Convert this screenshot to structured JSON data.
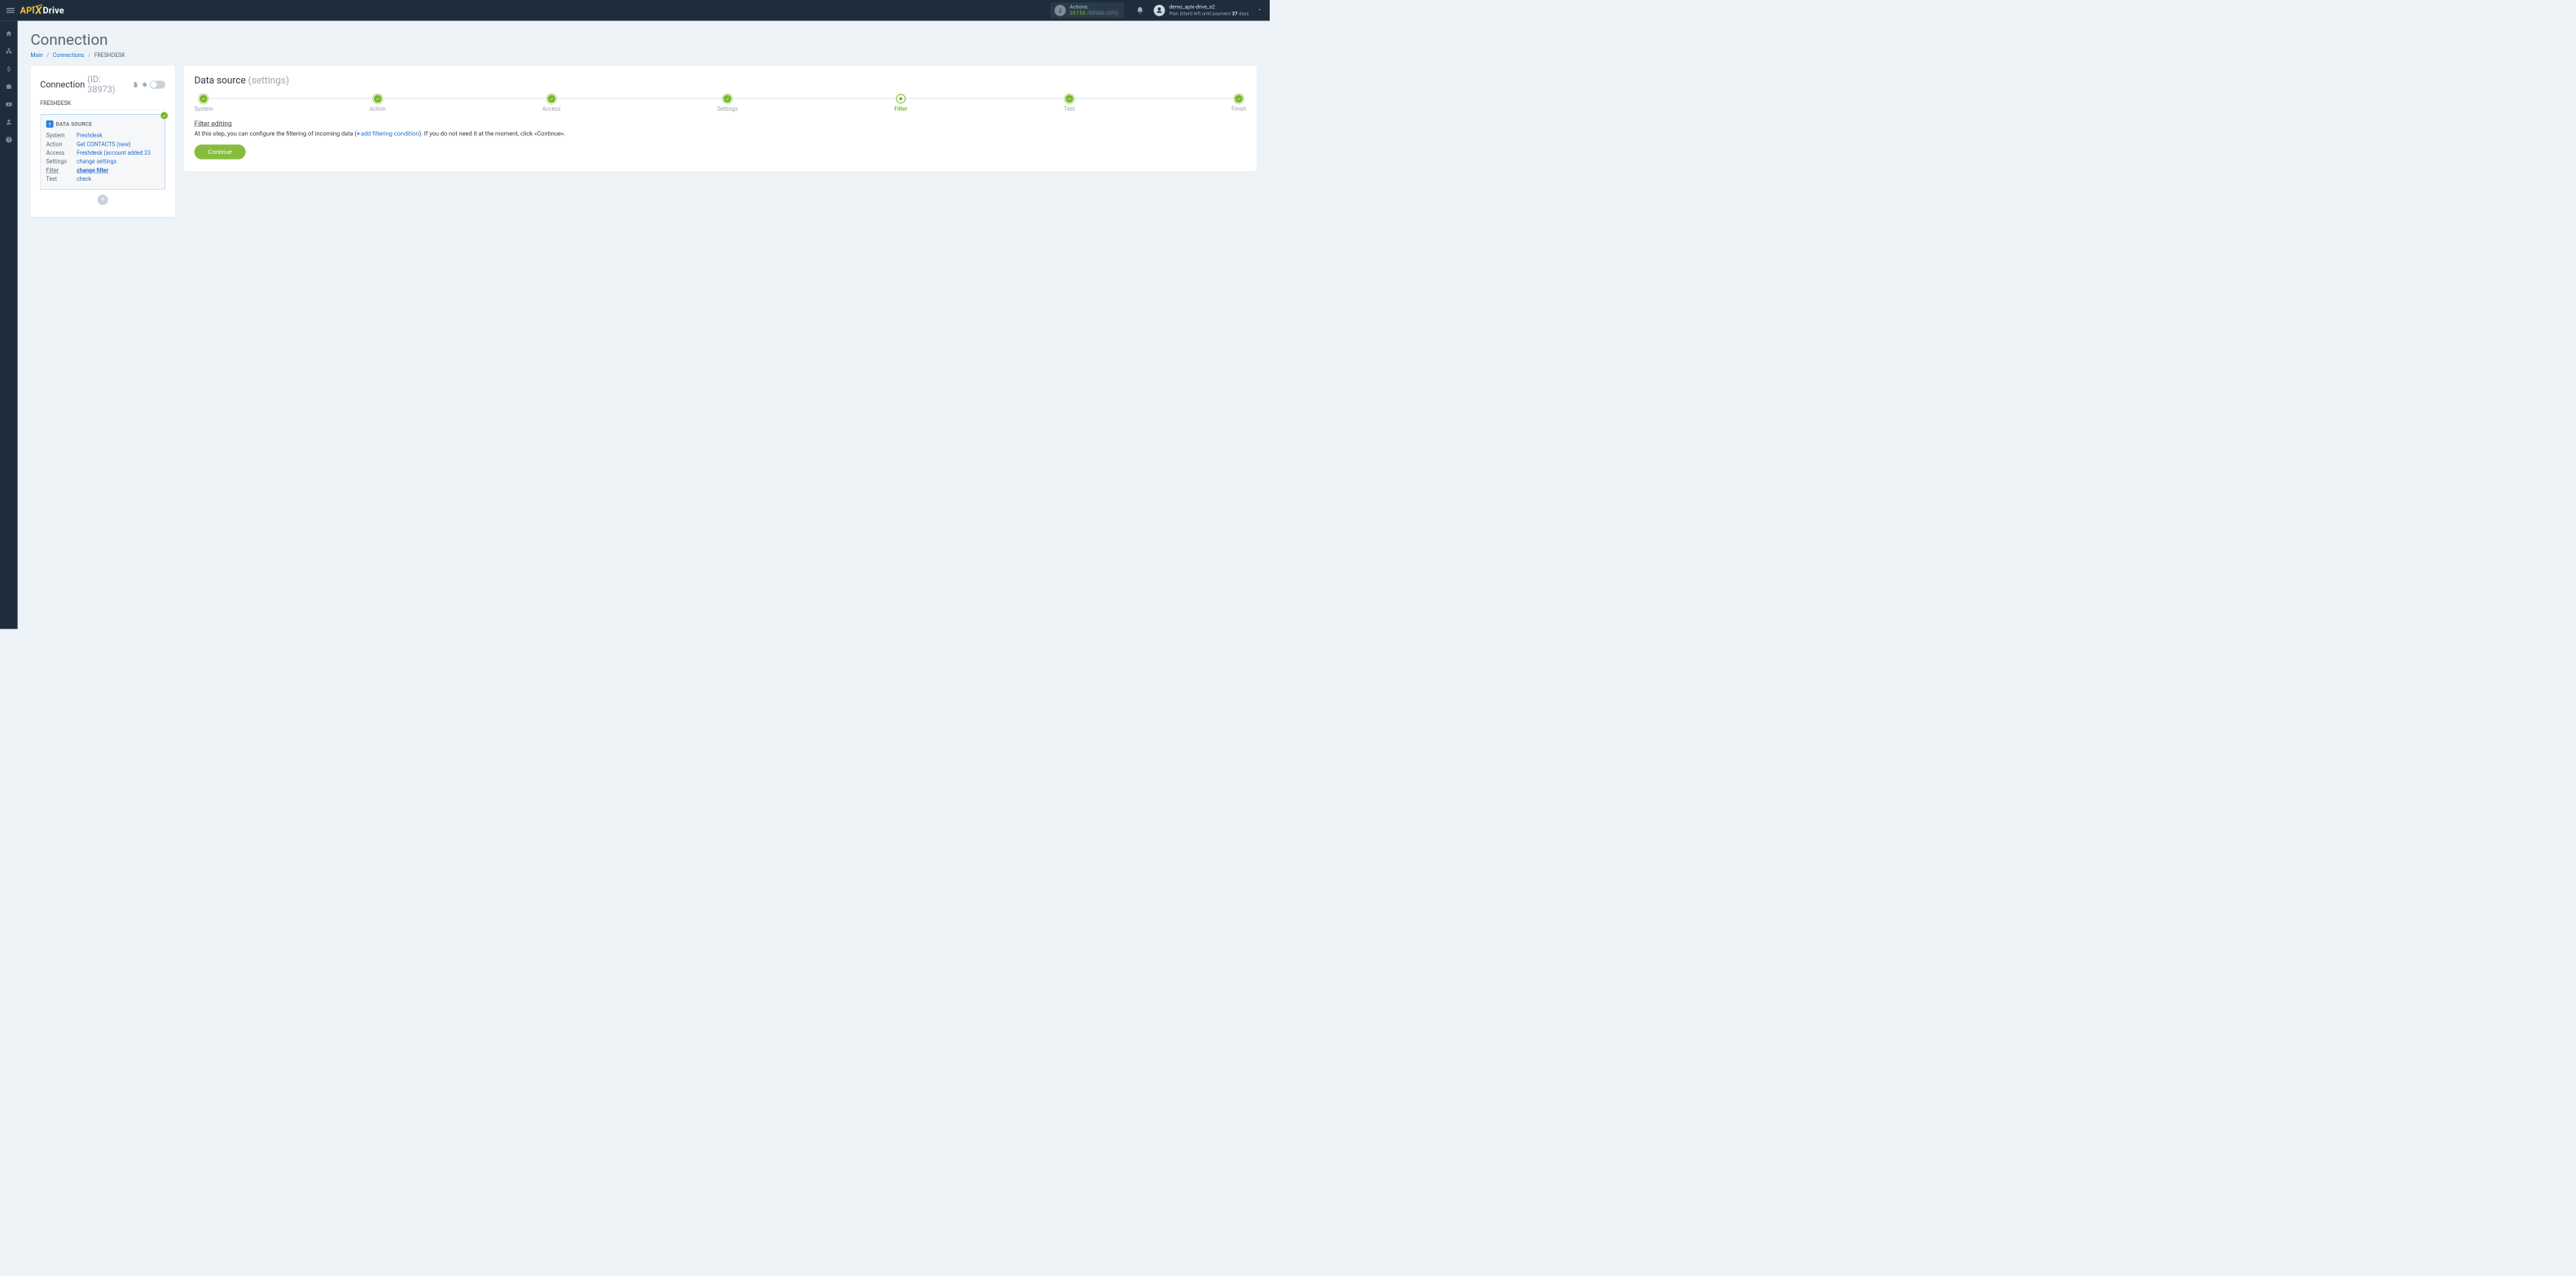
{
  "header": {
    "logo_api": "API",
    "logo_x": "X",
    "logo_drive": "Drive",
    "actions_label": "Actions:",
    "actions_used": "25'153",
    "actions_sep": "/",
    "actions_limit": "50'000",
    "actions_percent": "(50%)",
    "user_name": "demo_apix-drive_s2",
    "user_plan_prefix": "Plan |Start| left until payment ",
    "user_plan_days": "27",
    "user_plan_suffix": " days"
  },
  "page": {
    "title": "Connection"
  },
  "breadcrumb": {
    "main": "Main",
    "connections": "Connections",
    "current": "FRESHDESK"
  },
  "left": {
    "conn_label": "Connection",
    "conn_id": "(ID: 38973)",
    "conn_name": "FRESHDESK",
    "ds_badge": "1",
    "ds_title": "DATA SOURCE",
    "rows": {
      "system_l": "System",
      "system_v": "Freshdesk",
      "action_l": "Action",
      "action_v": "Get CONTACTS (new)",
      "access_l": "Access",
      "access_v": "Freshdesk (account added 23",
      "settings_l": "Settings",
      "settings_v": "change settings",
      "filter_l": "Filter",
      "filter_v": "change filter",
      "test_l": "Test",
      "test_v": "check"
    },
    "add": "+"
  },
  "right": {
    "title": "Data source",
    "title_sub": "(settings)",
    "steps": {
      "system": "System",
      "action": "Action",
      "access": "Access",
      "settings": "Settings",
      "filter": "Filter",
      "test": "Test",
      "finish": "Finish"
    },
    "filter_title": "Filter editing",
    "desc_before": "At this step, you can configure the filtering of incoming data (",
    "desc_link": "add filtering condition",
    "desc_after": "). If you do not need it at the moment, click «Continue».",
    "continue": "Continue"
  }
}
